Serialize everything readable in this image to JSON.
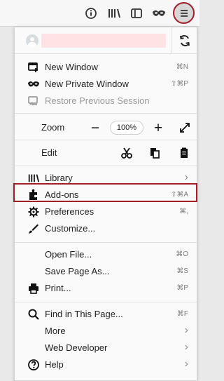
{
  "toolbar": {
    "info_icon": "info-icon",
    "library_icon": "library-icon",
    "sidebar_icon": "sidebar-icon",
    "private_icon": "mask-icon",
    "menu_icon": "hamburger-menu-icon"
  },
  "account": {
    "avatar": "user-avatar-icon",
    "sync_icon": "sync-icon"
  },
  "menu": {
    "new_window": {
      "label": "New Window",
      "shortcut": "⌘N"
    },
    "new_private_window": {
      "label": "New Private Window",
      "shortcut": "⇧⌘P"
    },
    "restore_session": {
      "label": "Restore Previous Session"
    },
    "zoom": {
      "label": "Zoom",
      "value": "100%"
    },
    "edit": {
      "label": "Edit"
    },
    "library": {
      "label": "Library"
    },
    "addons": {
      "label": "Add-ons",
      "shortcut": "⇧⌘A"
    },
    "preferences": {
      "label": "Preferences",
      "shortcut": "⌘,"
    },
    "customize": {
      "label": "Customize..."
    },
    "open_file": {
      "label": "Open File...",
      "shortcut": "⌘O"
    },
    "save_page": {
      "label": "Save Page As...",
      "shortcut": "⌘S"
    },
    "print": {
      "label": "Print...",
      "shortcut": "⌘P"
    },
    "find": {
      "label": "Find in This Page...",
      "shortcut": "⌘F"
    },
    "more": {
      "label": "More"
    },
    "web_developer": {
      "label": "Web Developer"
    },
    "help": {
      "label": "Help"
    }
  },
  "colors": {
    "highlight": "#a11f27",
    "account_placeholder": "#fde3e3"
  }
}
